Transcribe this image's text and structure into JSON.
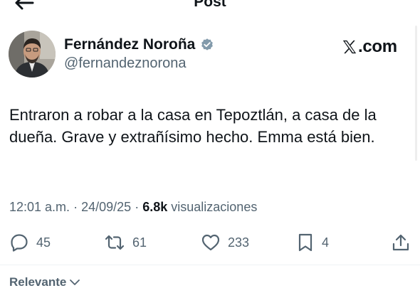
{
  "header": {
    "title": "Post",
    "back_icon": "arrow-left-icon",
    "more_icon": "more-horizontal-icon"
  },
  "author": {
    "name": "Fernández Noroña",
    "handle": "@fernandeznorona",
    "verified_icon": "verified-badge-icon",
    "verified_color": "#829aab"
  },
  "watermark": {
    "logo_icon": "x-logo-icon",
    "text": ".com"
  },
  "post": {
    "text": "Entraron a robar a la casa en Tepoztlán, a casa de la dueña. Grave y extrañísimo hecho. Emma está bien.",
    "time": "12:01 a.m.",
    "separator": "·",
    "date": "24/09/25",
    "views_count": "6.8k",
    "views_label": "visualizaciones"
  },
  "actions": {
    "replies": "45",
    "reposts": "61",
    "likes": "233",
    "bookmarks": "4"
  },
  "replies_sort": {
    "label": "Relevante",
    "icon": "chevron-down-icon"
  },
  "colors": {
    "text_primary": "#0f1419",
    "text_secondary": "#536471",
    "background": "#ffffff"
  }
}
